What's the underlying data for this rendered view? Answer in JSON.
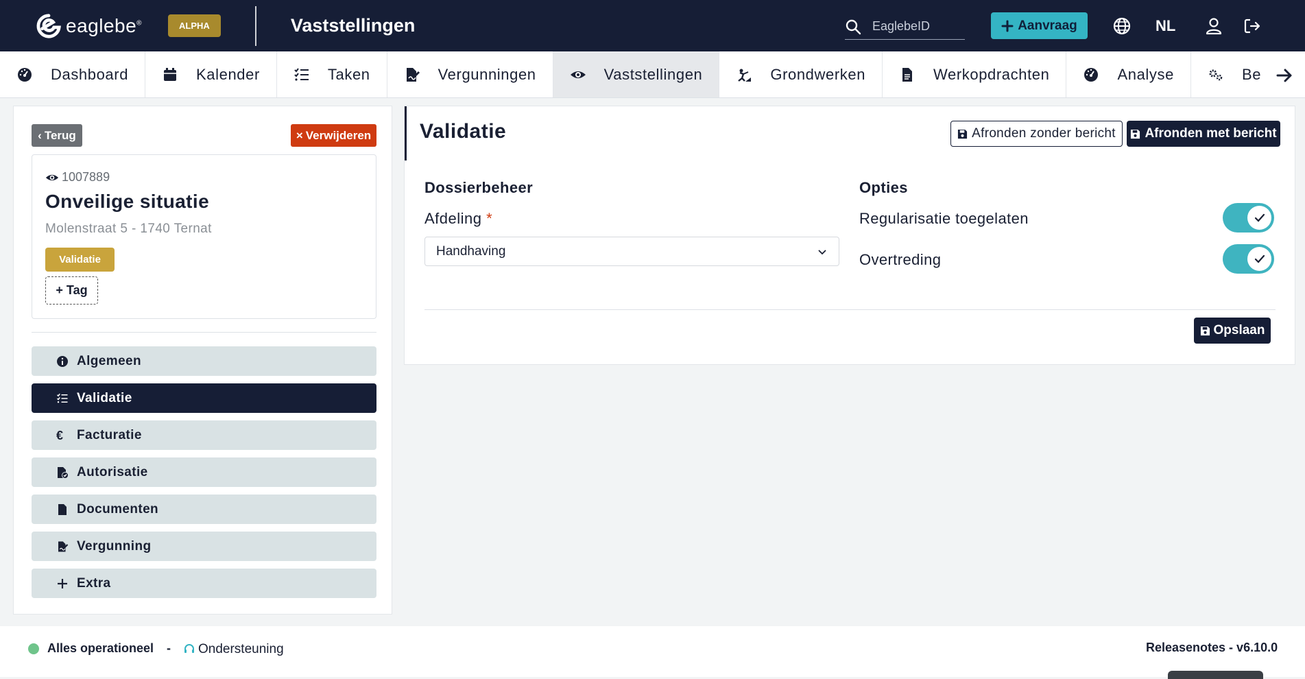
{
  "header": {
    "logo_text": "eaglebe",
    "logo_reg": "®",
    "alpha_label": "ALPHA",
    "app_title": "Vaststellingen",
    "search_placeholder": "EaglebeID",
    "aanvraag_label": "Aanvraag",
    "language": "NL"
  },
  "nav": {
    "tabs": [
      {
        "label": "Dashboard",
        "icon": "gauge-icon"
      },
      {
        "label": "Kalender",
        "icon": "calendar-icon"
      },
      {
        "label": "Taken",
        "icon": "checklist-icon"
      },
      {
        "label": "Vergunningen",
        "icon": "file-signature-icon"
      },
      {
        "label": "Vaststellingen",
        "icon": "eye-icon",
        "active": true
      },
      {
        "label": "Grondwerken",
        "icon": "digging-icon"
      },
      {
        "label": "Werkopdrachten",
        "icon": "document-icon"
      },
      {
        "label": "Analyse",
        "icon": "gauge-icon"
      },
      {
        "label": "Be",
        "icon": "cogs-icon"
      }
    ]
  },
  "case": {
    "back_label": "Terug",
    "delete_label": "Verwijderen",
    "id": "1007889",
    "title": "Onveilige situatie",
    "address": "Molenstraat 5 - 1740 Ternat",
    "status": "Validatie",
    "tag_label": "+ Tag"
  },
  "sidebar": {
    "items": [
      {
        "label": "Algemeen",
        "icon": "info-icon"
      },
      {
        "label": "Validatie",
        "icon": "checklist-icon",
        "active": true
      },
      {
        "label": "Facturatie",
        "icon": "euro-icon"
      },
      {
        "label": "Autorisatie",
        "icon": "file-check-icon"
      },
      {
        "label": "Documenten",
        "icon": "document-icon"
      },
      {
        "label": "Vergunning",
        "icon": "file-signature-icon"
      },
      {
        "label": "Extra",
        "icon": "plus-icon"
      }
    ]
  },
  "main": {
    "title": "Validatie",
    "finish_without_label": "Afronden zonder bericht",
    "finish_with_label": "Afronden met bericht",
    "dossier_heading": "Dossierbeheer",
    "department_label": "Afdeling",
    "department_value": "Handhaving",
    "options_heading": "Opties",
    "options": [
      {
        "label": "Regularisatie toegelaten",
        "enabled": true
      },
      {
        "label": "Overtreding",
        "enabled": true
      }
    ],
    "save_label": "Opslaan"
  },
  "footer": {
    "status_text": "Alles operationeel",
    "separator": "-",
    "support_label": "Ondersteuning",
    "release_text": "Releasenotes - v6.10.0"
  },
  "colors": {
    "navy": "#161e36",
    "teal": "#34b4c4",
    "gold": "#c9a43c",
    "danger": "#cf3b11",
    "status_ok": "#6fc48b"
  }
}
